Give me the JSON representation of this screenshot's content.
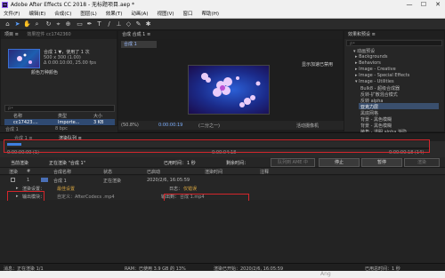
{
  "window": {
    "app_icon": "Ae",
    "title": "Adobe After Effects CC 2018 - 无标题项目.aep *",
    "minimize": "—",
    "maximize": "☐",
    "close": "✕"
  },
  "menu": [
    "文件(F)",
    "编辑(E)",
    "合成(C)",
    "图层(L)",
    "效果(T)",
    "动画(A)",
    "视图(V)",
    "窗口",
    "帮助(H)"
  ],
  "project": {
    "tab_project": "项目 ≡",
    "tab_effects": "效果控件 cc1742360",
    "item_name": "合成 1 ▼，使用了 1 次",
    "item_dims": "500 x 300 (1.00)",
    "item_duration": "Δ 0:00:10:00, 25.00 fps",
    "thumb_caption": "颜色万种颜色",
    "search_placeholder": "ρ•",
    "col_name": "名称",
    "col_type": "类型",
    "col_size": "大小",
    "files": [
      {
        "name": "cc17423....",
        "type": "Importe...",
        "size": "3 KB"
      },
      {
        "name": "合成 1",
        "type": "合成",
        "size": ""
      }
    ],
    "bpc": "8 bpc"
  },
  "composition": {
    "tab": "合成 合成 1 ≡",
    "subtab": "合成 1",
    "warning": "显示加速已禁用",
    "zoom": "(50.8%)",
    "time": "0:00:00:19",
    "quality": "(二分之一)",
    "camera": "活动摄像机"
  },
  "effects": {
    "tab": "效果和预设 ≡",
    "search_placeholder": "ρ•",
    "items": [
      "▾ 动画预设",
      "▸ Backgrounds",
      "▸ Behaviors",
      "▸ Image - Creative",
      "▸ Image - Special Effects",
      "▾ Image - Utilities",
      "  Bulk8 - 超级合成器",
      "  反转-扩散混合模式",
      "  反转 alpha",
      "  亚克力层",
      "  黑底网格",
      "  背景 - 黑色模糊",
      "  背景 - 黑色模糊",
      "  棱角 - 透明 alpha 渐隐"
    ]
  },
  "timeline": {
    "tab_comp": "合成 1 ≡",
    "tab_render": "渲染队列 ≡",
    "time_start": "0:00:00:00 (1)",
    "time_mid": "0:00:04:18",
    "time_end": "0:00:00:18 (14)"
  },
  "render": {
    "current_render": "当前渲染",
    "rendering_label": "正在渲染 \"合成 1\"",
    "elapsed_label": "已用时间：",
    "elapsed": "1 秒",
    "remaining_label": "剩余时间：",
    "btn_media_encoder": "队列到 AME 中",
    "btn_stop": "停止",
    "btn_pause": "暂停",
    "btn_render": "渲染",
    "cols": [
      "渲染",
      "#",
      "合成名称",
      "状态",
      "已启动",
      "渲染时间",
      "注释"
    ],
    "job_num": "1",
    "job_name": "合成 1",
    "job_status": "正在渲染",
    "job_started": "2020/2/6, 16:05:59",
    "settings_label": "渲染设置：",
    "settings_value": "最佳设置",
    "log_label": "日志：",
    "log_value": "仅错误",
    "output_label": "输出模块：",
    "output_value": "自定义：AfterCodecs .mp4",
    "output_to_label": "输出到：",
    "output_to_value": "合成 1.mp4"
  },
  "statusbar": {
    "message": "消息：正在渲染 1/1",
    "ram": "RAM：已使用 3.9 GB 的 13%",
    "started": "渲染已开始：2020/2/6, 16:05:59",
    "total": "已用总时间：1 秒",
    "watermark": "Ang"
  }
}
